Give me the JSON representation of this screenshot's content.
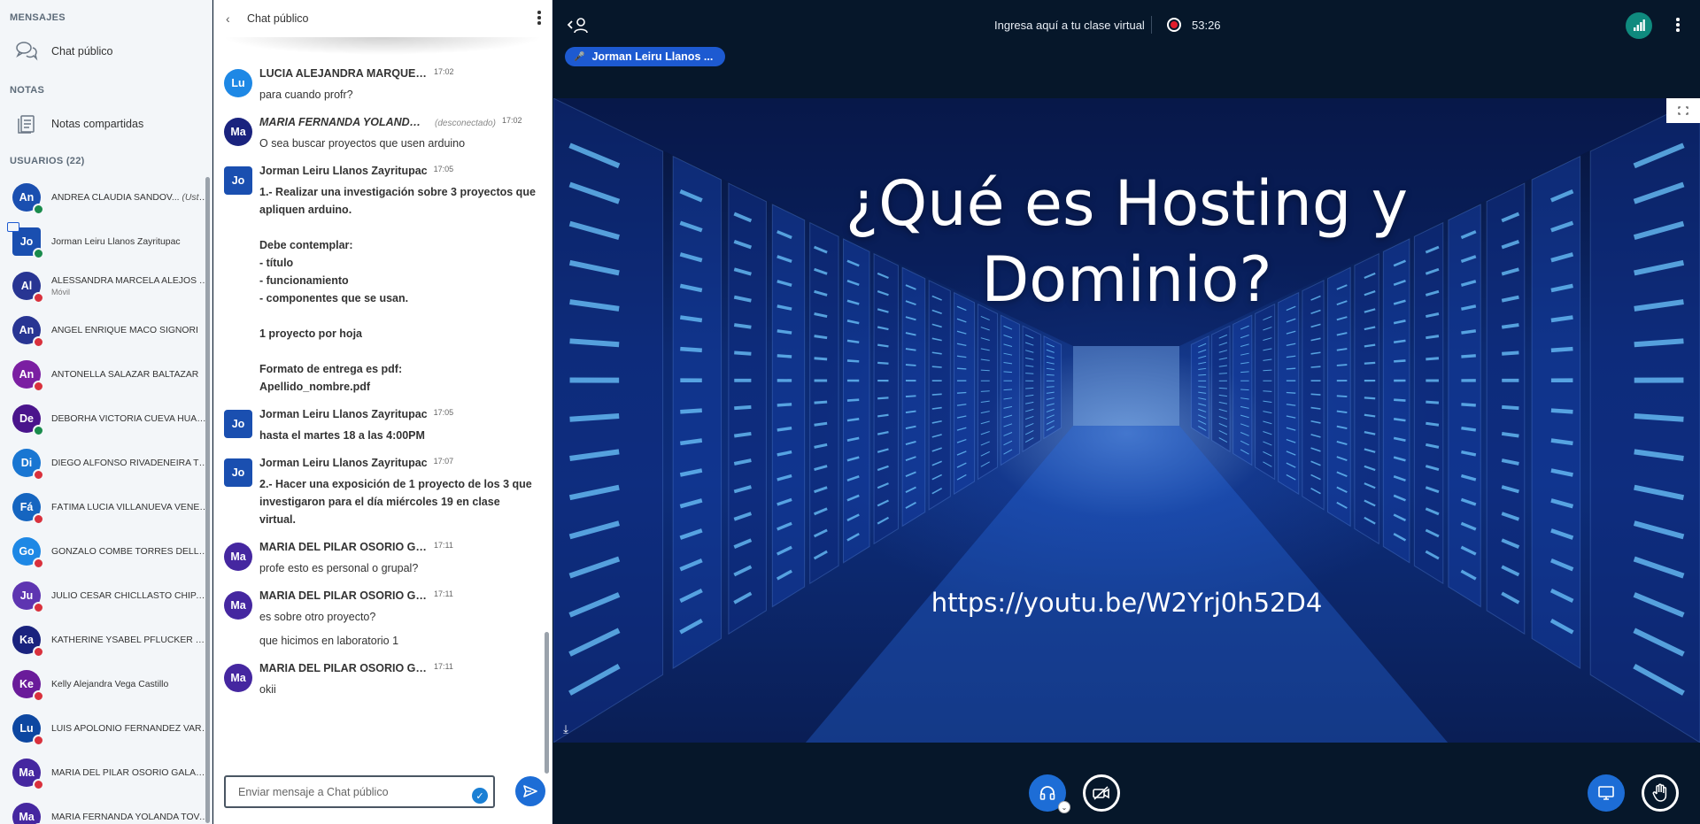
{
  "sidebar": {
    "messages_title": "MENSAJES",
    "public_chat": "Chat público",
    "notes_title": "NOTAS",
    "shared_notes": "Notas compartidas",
    "users_title": "USUARIOS (22)",
    "users": [
      {
        "initials": "An",
        "name": "ANDREA CLAUDIA SANDOV...",
        "you": "(Usted)",
        "color": "#1a4fb0",
        "status": "mic",
        "sub": ""
      },
      {
        "initials": "Jo",
        "name": "Jorman Leiru Llanos Zayritupac",
        "you": "",
        "color": "#1a4fb0",
        "status": "mic",
        "moderator": true,
        "presenter": true,
        "sub": ""
      },
      {
        "initials": "Al",
        "name": "ALESSANDRA MARCELA ALEJOS YA...",
        "you": "",
        "color": "#283593",
        "status": "mute",
        "sub": "Móvil"
      },
      {
        "initials": "An",
        "name": "ANGEL ENRIQUE MACO SIGNORI",
        "you": "",
        "color": "#283593",
        "status": "mute",
        "sub": ""
      },
      {
        "initials": "An",
        "name": "ANTONELLA SALAZAR BALTAZAR",
        "you": "",
        "color": "#7b1fa2",
        "status": "mute",
        "sub": ""
      },
      {
        "initials": "De",
        "name": "DEBORHA VICTORIA CUEVA HUAPA...",
        "you": "",
        "color": "#4a148c",
        "status": "mic",
        "sub": ""
      },
      {
        "initials": "Di",
        "name": "DIEGO ALFONSO RIVADENEIRA TU...",
        "you": "",
        "color": "#1976d2",
        "status": "mute",
        "sub": ""
      },
      {
        "initials": "Fá",
        "name": "FÁTIMA LUCIA VILLANUEVA VENEG...",
        "you": "",
        "color": "#1565c0",
        "status": "mute",
        "sub": ""
      },
      {
        "initials": "Go",
        "name": "GONZALO COMBE TORRES DELLA ...",
        "you": "",
        "color": "#1e88e5",
        "status": "mute",
        "sub": ""
      },
      {
        "initials": "Ju",
        "name": "JULIO CESAR CHICLLASTO CHIPANA",
        "you": "",
        "color": "#5e35b1",
        "status": "mute",
        "sub": ""
      },
      {
        "initials": "Ka",
        "name": "KATHERINE YSABEL PFLUCKER GU...",
        "you": "",
        "color": "#1a237e",
        "status": "mute",
        "sub": ""
      },
      {
        "initials": "Ke",
        "name": "Kelly Alejandra Vega Castillo",
        "you": "",
        "color": "#6a1b9a",
        "status": "mute",
        "sub": ""
      },
      {
        "initials": "Lu",
        "name": "LUIS APOLONIO FERNANDEZ VARG...",
        "you": "",
        "color": "#0d47a1",
        "status": "mute",
        "sub": ""
      },
      {
        "initials": "Ma",
        "name": "MARIA DEL PILAR OSORIO GALARZA",
        "you": "",
        "color": "#4527a0",
        "status": "mute",
        "sub": ""
      },
      {
        "initials": "Ma",
        "name": "MARIA FERNANDA YOLANDA TOVA...",
        "you": "",
        "color": "#4527a0",
        "status": "mute",
        "sub": ""
      }
    ]
  },
  "chat": {
    "title": "Chat público",
    "placeholder": "Enviar mensaje a Chat público",
    "messages": [
      {
        "initials": "Lu",
        "color": "#1e88e5",
        "name": "LUCIA ALEJANDRA MARQUEZADO MIRABAL",
        "time": "17:02",
        "disconnected": "",
        "lines": [
          "para cuando profr?"
        ],
        "bold": false
      },
      {
        "initials": "Ma",
        "color": "#1a237e",
        "name": "MARIA FERNANDA YOLANDA T...",
        "italic_name": true,
        "time": "17:02",
        "disconnected": "(desconectado)",
        "lines": [
          "O sea buscar proyectos que usen arduino"
        ],
        "bold": false
      },
      {
        "initials": "Jo",
        "color": "#1a4fb0",
        "moderator": true,
        "name": "Jorman Leiru Llanos Zayritupac",
        "time": "17:05",
        "disconnected": "",
        "lines": [
          "1.- Realizar una investigación sobre 3 proyectos que apliquen arduino.\n\nDebe contemplar:\n- título\n- funcionamiento\n- componentes que se usan.\n\n1 proyecto por hoja\n\nFormato de entrega es pdf:\nApellido_nombre.pdf"
        ],
        "bold": true
      },
      {
        "initials": "Jo",
        "color": "#1a4fb0",
        "moderator": true,
        "name": "Jorman Leiru Llanos Zayritupac",
        "time": "17:05",
        "disconnected": "",
        "lines": [
          "hasta el martes 18 a las 4:00PM"
        ],
        "bold": true
      },
      {
        "initials": "Jo",
        "color": "#1a4fb0",
        "moderator": true,
        "name": "Jorman Leiru Llanos Zayritupac",
        "time": "17:07",
        "disconnected": "",
        "lines": [
          "2.- Hacer una exposición de 1 proyecto de los 3 que investigaron para el día miércoles 19 en clase virtual."
        ],
        "bold": true
      },
      {
        "initials": "Ma",
        "color": "#4527a0",
        "name": "MARIA DEL PILAR OSORIO GALARZA",
        "time": "17:11",
        "disconnected": "",
        "lines": [
          "profe esto es personal o grupal?"
        ],
        "bold": false
      },
      {
        "initials": "Ma",
        "color": "#4527a0",
        "name": "MARIA DEL PILAR OSORIO GALARZA",
        "time": "17:11",
        "disconnected": "",
        "lines": [
          "es sobre otro proyecto?",
          "que hicimos en laboratorio 1"
        ],
        "bold": false
      },
      {
        "initials": "Ma",
        "color": "#4527a0",
        "name": "MARIA DEL PILAR OSORIO GALARZA",
        "time": "17:11",
        "disconnected": "",
        "lines": [
          "okii"
        ],
        "bold": false
      }
    ]
  },
  "topbar": {
    "meeting_title": "Ingresa aquí a tu clase virtual",
    "recording_time": "53:26",
    "talker": "Jorman Leiru Llanos ..."
  },
  "slide": {
    "title_line1": "¿Qué es Hosting y",
    "title_line2": "Dominio?",
    "link": "https://youtu.be/W2Yrj0h52D4"
  },
  "icons": {
    "chat": "chat-bubbles-icon",
    "notes": "notes-icon",
    "audio": "headphones-icon",
    "camera": "camera-off-icon",
    "present": "screen-share-icon",
    "hand": "raise-hand-icon",
    "connection": "signal-bars-icon"
  },
  "colors": {
    "accent": "#1d6dd6",
    "dark_bg": "#06172a",
    "mic_on": "#1a8b4c",
    "muted": "#d9313d",
    "connection": "#0f8a7e"
  }
}
